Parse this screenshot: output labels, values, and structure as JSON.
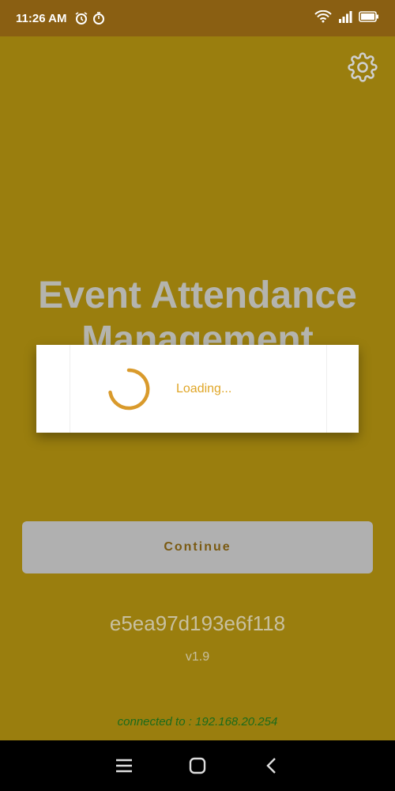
{
  "status_bar": {
    "time": "11:26 AM",
    "icons_left": [
      "alarm-icon",
      "timer-icon"
    ],
    "icons_right": [
      "wifi-icon",
      "signal-icon",
      "battery-icon"
    ]
  },
  "app": {
    "title_line1": "Event Attendance",
    "title_line2": "Management",
    "continue_label": "Continue",
    "device_id": "e5ea97d193e6f118",
    "version": "v1.9",
    "connection": "connected to : 192.168.20.254"
  },
  "dialog": {
    "loading_text": "Loading..."
  },
  "colors": {
    "status_bar": "#8a5f12",
    "background": "#9a7e0e",
    "accent": "#e0a627",
    "spinner": "#d99a2b",
    "connection_text": "#1b6b1b"
  },
  "nav_bar": {
    "buttons": [
      "menu-icon",
      "home-icon",
      "back-icon"
    ]
  }
}
